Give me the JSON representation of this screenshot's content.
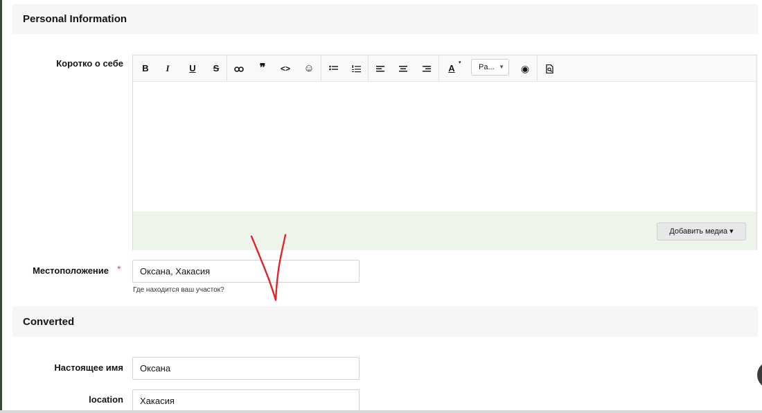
{
  "sections": {
    "personal": {
      "title": "Personal Information"
    },
    "converted": {
      "title": "Converted"
    }
  },
  "about": {
    "label": "Коротко о себе",
    "toolbar": {
      "bold": "B",
      "italic": "I",
      "underline": "U",
      "strike": "S",
      "quote": "❞",
      "code": "<>",
      "smilie": "☺",
      "font_color": "A",
      "style_select": "Pa...",
      "preview": "◉"
    },
    "media_button": "Добавить медиа ▾"
  },
  "location_field": {
    "label": "Местоположение",
    "required": "*",
    "value": "Оксана, Хакасия",
    "hint": "Где находится ваш участок?"
  },
  "real_name_field": {
    "label": "Настоящее имя",
    "value": "Оксана"
  },
  "location2_field": {
    "label": "location",
    "value": "Хакасия"
  },
  "colors": {
    "accent_required": "#e0473c",
    "footer_bg": "#edf5ea",
    "section_bg": "#f5f5f5",
    "scribble": "#e0242b"
  }
}
